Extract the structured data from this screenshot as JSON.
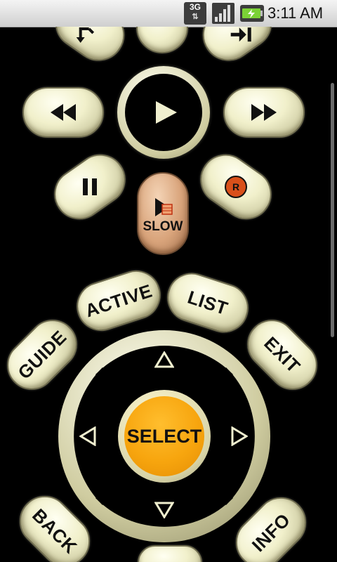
{
  "status_bar": {
    "network_type": "3G",
    "time": "3:11 AM",
    "icons": [
      "network-3g-icon",
      "signal-strength-icon",
      "battery-charging-icon"
    ]
  },
  "remote": {
    "buttons": {
      "slow": "SLOW",
      "active": "ACTIVE",
      "list": "LIST",
      "guide": "GUIDE",
      "exit": "EXIT",
      "select": "SELECT",
      "back": "BACK",
      "info": "INFO",
      "record": "R"
    },
    "icons": {
      "replay": "replay-icon",
      "skip": "skip-forward-icon",
      "rewind": "rewind-icon",
      "play": "play-icon",
      "fast_forward": "fast-forward-icon",
      "pause": "pause-icon",
      "up": "arrow-up-icon",
      "down": "arrow-down-icon",
      "left": "arrow-left-icon",
      "right": "arrow-right-icon"
    },
    "colors": {
      "button_face": "#f1f0cb",
      "select_orange": "#f7a50e",
      "slow_copper": "#d9a47b",
      "record_red": "#d9501b",
      "background": "#000000"
    }
  }
}
